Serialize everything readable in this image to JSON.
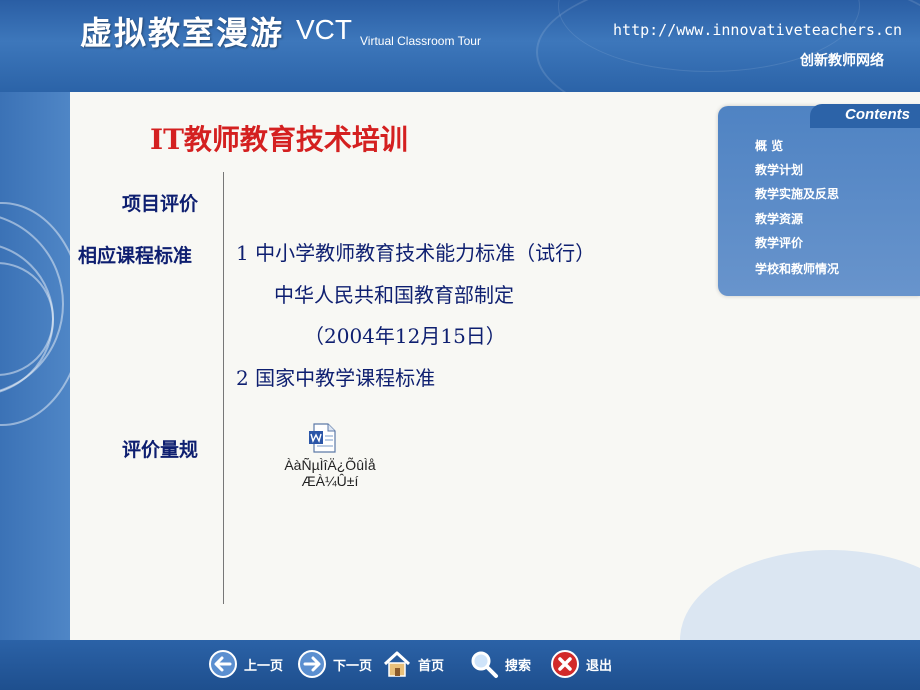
{
  "header": {
    "title_cn": "虚拟教室漫游",
    "title_en": "VCT",
    "subtitle_en": "Virtual Classroom Tour",
    "url": "http://www.innovativeteachers.cn",
    "network_name": "创新教师网络"
  },
  "main": {
    "heading": "IT教师教育技术培训",
    "rows": [
      {
        "label": "项目评价"
      },
      {
        "label": "相应课程标准"
      },
      {
        "label": "评价量规"
      }
    ],
    "standards": [
      "1 中小学教师教育技术能力标准（试行）",
      "中华人民共和国教育部制定",
      "（2004年12月15日）",
      "2 国家中教学课程标准"
    ],
    "attachment": {
      "icon": "word-document-icon",
      "caption_line1": "ÀàÑµÌîÄ¿ÕûÌå",
      "caption_line2": "ÆÀ¼Û±í"
    }
  },
  "contents_panel": {
    "title": "Contents",
    "items": [
      "概 览",
      "教学计划",
      "教学实施及反思",
      "教学资源",
      "教学评价",
      "学校和教师情况"
    ]
  },
  "footer": {
    "prev": "上一页",
    "next": "下一页",
    "home": "首页",
    "search": "搜索",
    "exit": "退出"
  },
  "colors": {
    "heading_red": "#d42020",
    "text_navy": "#0e1f70",
    "header_blue": "#2a5ea4",
    "background": "#f8f8f4"
  }
}
